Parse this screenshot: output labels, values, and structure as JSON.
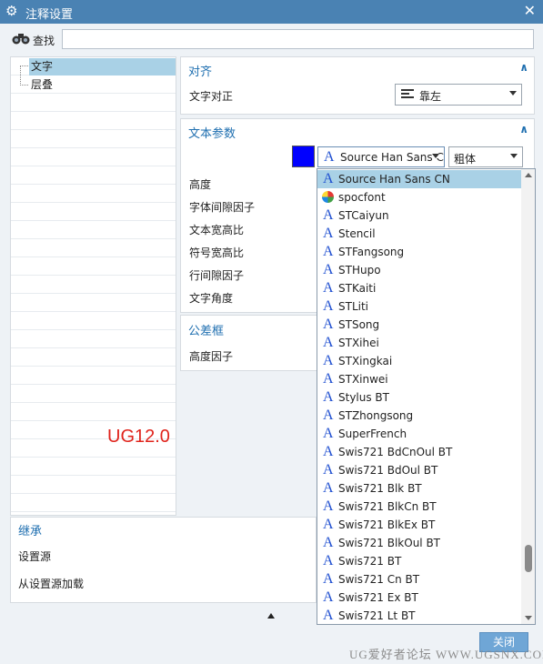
{
  "window": {
    "title": "注释设置",
    "close_symbol": "✕"
  },
  "search": {
    "label": "查找",
    "value": ""
  },
  "tree": {
    "items": [
      {
        "label": "文字",
        "selected": true
      },
      {
        "label": "层叠",
        "selected": false
      }
    ]
  },
  "overlay": {
    "version_label": "UG12.0",
    "site_watermark": "UG爱好者论坛 WWW.UGSNX.COM"
  },
  "align_section": {
    "title": "对齐",
    "text_align_label": "文字对正",
    "text_align_value": "靠左"
  },
  "text_params": {
    "title": "文本参数",
    "color": "#0000ff",
    "font_value": "Source Han Sans CN",
    "style_value": "粗体",
    "fields": [
      "高度",
      "字体间隙因子",
      "文本宽高比",
      "符号宽高比",
      "行间隙因子",
      "文字角度"
    ]
  },
  "tolerance_section": {
    "title": "公差框",
    "height_factor_label": "高度因子"
  },
  "inherit_section": {
    "title": "继承",
    "source_label": "设置源",
    "load_label": "从设置源加载"
  },
  "font_dropdown": {
    "items": [
      "Source Han Sans CN",
      "spocfont",
      "STCaiyun",
      "Stencil",
      "STFangsong",
      "STHupo",
      "STKaiti",
      "STLiti",
      "STSong",
      "STXihei",
      "STXingkai",
      "STXinwei",
      "Stylus BT",
      "STZhongsong",
      "SuperFrench",
      "Swis721 BdCnOul BT",
      "Swis721 BdOul BT",
      "Swis721 Blk BT",
      "Swis721 BlkCn BT",
      "Swis721 BlkEx BT",
      "Swis721 BlkOul BT",
      "Swis721 BT",
      "Swis721 Cn BT",
      "Swis721 Ex BT",
      "Swis721 Lt BT"
    ],
    "selected_index": 0,
    "special_icon_index": 1,
    "glyph": "A"
  },
  "footer": {
    "close_label": "关闭"
  }
}
